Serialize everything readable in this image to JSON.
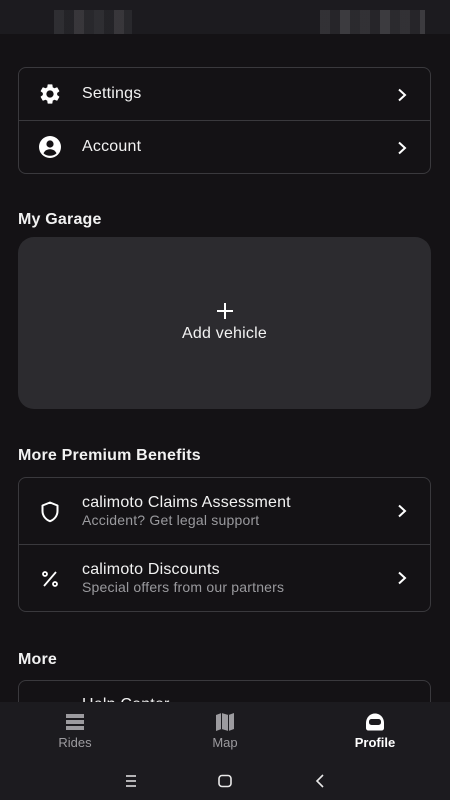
{
  "menu": {
    "settings_label": "Settings",
    "account_label": "Account"
  },
  "garage": {
    "section_title": "My Garage",
    "add_vehicle_label": "Add vehicle"
  },
  "premium": {
    "section_title": "More Premium Benefits",
    "items": [
      {
        "title": "calimoto Claims Assessment",
        "subtitle": "Accident? Get legal support"
      },
      {
        "title": "calimoto Discounts",
        "subtitle": "Special offers from our partners"
      }
    ]
  },
  "more": {
    "section_title": "More",
    "first_item_label": "Help Center"
  },
  "bottom_nav": {
    "items": [
      {
        "label": "Rides",
        "active": false
      },
      {
        "label": "Map",
        "active": false
      },
      {
        "label": "Profile",
        "active": true
      }
    ]
  },
  "icons": {
    "settings": "gear-icon",
    "account": "account-circle-icon",
    "claims": "shield-icon",
    "discounts": "percent-icon",
    "rides": "rides-list-icon",
    "map": "map-icon",
    "profile": "helmet-icon"
  },
  "colors": {
    "background": "#141215",
    "card_border": "#3a393d",
    "garage_tile": "#2c2b2f",
    "nav_background": "#1c1b1f",
    "text_primary": "#f2f2f2",
    "text_secondary": "#9a9a9e"
  }
}
